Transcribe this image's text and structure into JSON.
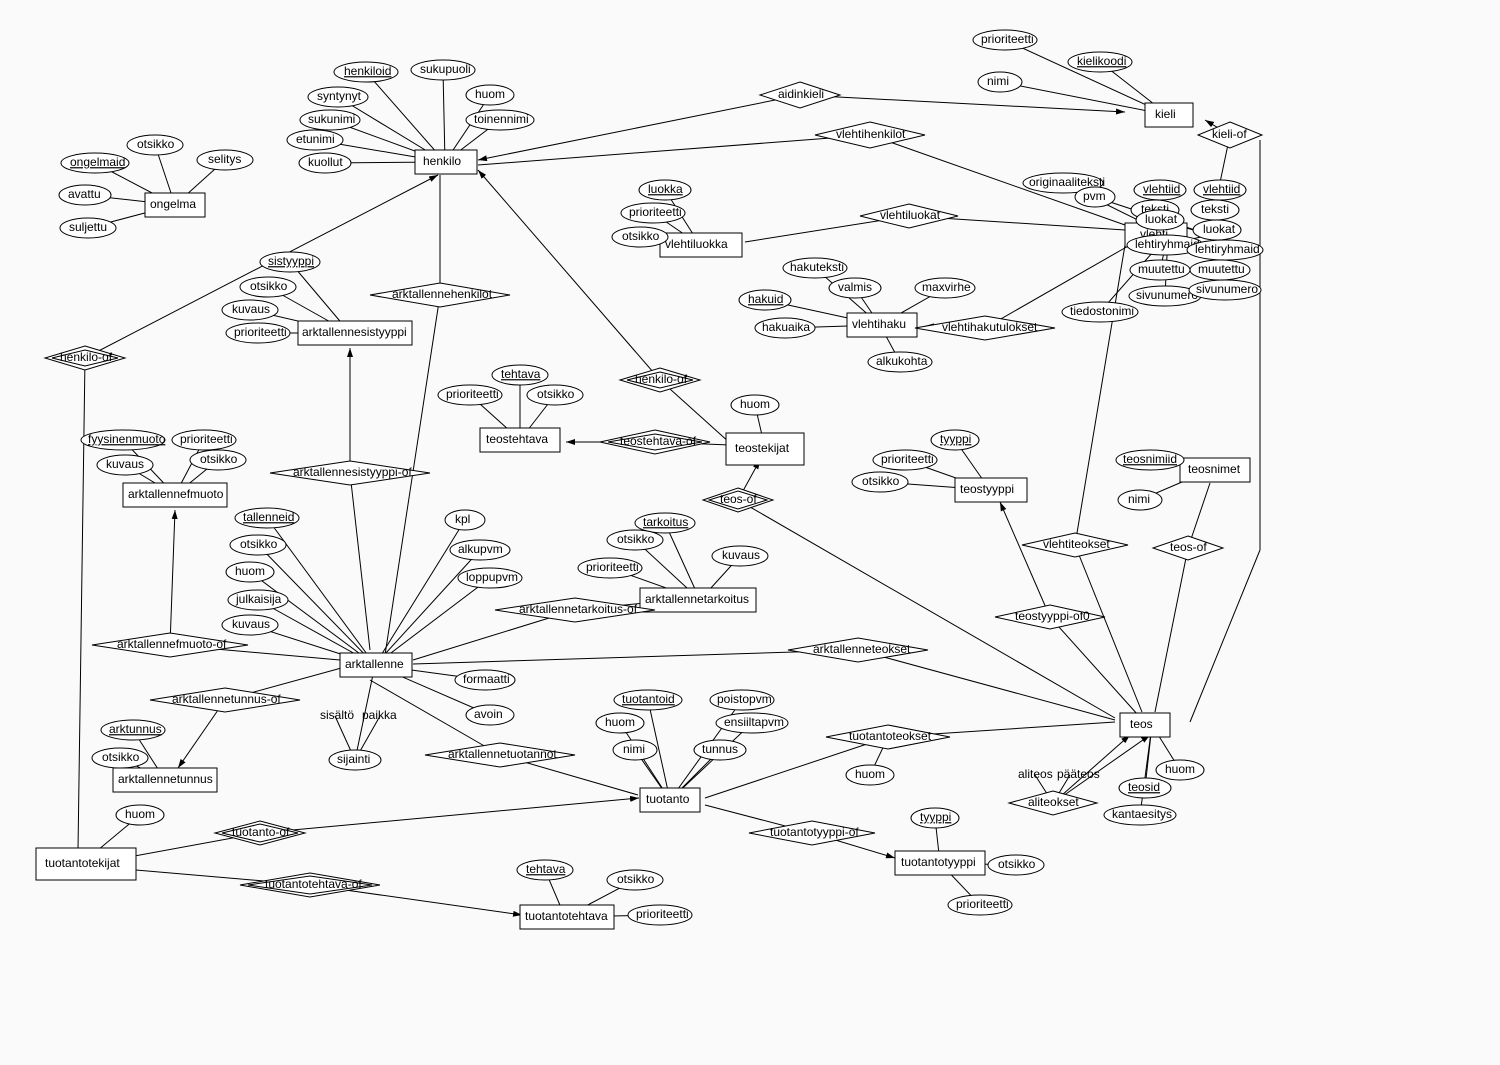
{
  "entities": {
    "ongelma": "ongelma",
    "henkilo": "henkilo",
    "kieli": "kieli",
    "vlehti": "vlehti",
    "vlehtiluokka": "vlehtiluokka",
    "vlehtihaku": "vlehtihaku",
    "arktallennesistyyppi": "arktallennesistyyppi",
    "teostehtava": "teostehtava",
    "teostekijat": "teostekijat",
    "teostyyppi": "teostyyppi",
    "teosnimet": "teosnimet",
    "arktallennefmuoto": "arktallennefmuoto",
    "arktallenne": "arktallenne",
    "arktallennetarkoitus": "arktallennetarkoitus",
    "arktallennetunnus": "arktallennetunnus",
    "tuotanto": "tuotanto",
    "teos": "teos",
    "tuotantotekijat": "tuotantotekijat",
    "tuotantotehtava": "tuotantotehtava",
    "tuotantotyyppi": "tuotantotyyppi"
  },
  "relationships": {
    "aidinkieli": "aidinkieli",
    "vlehtihenkilot": "vlehtihenkilot",
    "kieli_of": "kieli-of",
    "vlehtiluokat": "vlehtiluokat",
    "vlehtihakutulokset": "vlehtihakutulokset",
    "arktallennehenkilot": "arktallennehenkilot",
    "henkilo_of1": "henkilo-of",
    "henkilo_of2": "henkilo-of",
    "arktallennesistyyppi_of": "arktallennesistyyppi-of",
    "teostehtava_of": "teostehtava-of",
    "teos_of1": "teos-of",
    "teos_of2": "teos-of",
    "vlehtiteokset": "vlehtiteokset",
    "teostyyppi_of": "teostyyppi-of0",
    "arktallennefmuoto_of": "arktallennefmuoto-of",
    "arktallennetarkoitus_of": "arktallennetarkoitus-of",
    "arktallenneteokset": "arktallenneteokset",
    "arktallennetunnus_of": "arktallennetunnus-of",
    "arktallennetuotannot": "arktallennetuotannot",
    "tuotantoteokset": "tuotantoteokset",
    "aliteokset": "aliteokset",
    "tuotanto_of": "tuotanto-of",
    "tuotantotehtava_of": "tuotantotehtava-of",
    "tuotantotyyppi_of": "tuotantotyyppi-of"
  },
  "attributes": {
    "ongelma": {
      "ongelmaid": "ongelmaid",
      "otsikko": "otsikko",
      "selitys": "selitys",
      "avattu": "avattu",
      "suljettu": "suljettu"
    },
    "henkilo": {
      "henkiloid": "henkiloid",
      "sukupuoli": "sukupuoli",
      "huom": "huom",
      "toinennimi": "toinennimi",
      "syntynyt": "syntynyt",
      "sukunimi": "sukunimi",
      "etunimi": "etunimi",
      "kuollut": "kuollut"
    },
    "kieli": {
      "prioriteetti": "prioriteetti",
      "kielikoodi": "kielikoodi",
      "nimi": "nimi"
    },
    "vlehti": {
      "originaaliteksti": "originaaliteksti",
      "vlehtiid": "vlehtiid",
      "teksti": "teksti",
      "luokat": "luokat",
      "lehtiryhmaid": "lehtiryhmaid",
      "muutettu": "muutettu",
      "sivunumero": "sivunumero",
      "tiedostonimi": "tiedostonimi",
      "pvm": "pvm"
    },
    "vlehtiluokka": {
      "luokka": "luokka",
      "prioriteetti": "prioriteetti",
      "otsikko": "otsikko"
    },
    "vlehtihaku": {
      "hakuteksti": "hakuteksti",
      "valmis": "valmis",
      "maxvirhe": "maxvirhe",
      "hakuid": "hakuid",
      "hakuaika": "hakuaika",
      "alkukohta": "alkukohta"
    },
    "arktallennesistyyppi": {
      "sistyyppi": "sistyyppi",
      "otsikko": "otsikko",
      "kuvaus": "kuvaus",
      "prioriteetti": "prioriteetti"
    },
    "teostehtava": {
      "tehtava": "tehtava",
      "prioriteetti": "prioriteetti",
      "otsikko": "otsikko"
    },
    "teostekijat": {
      "huom": "huom"
    },
    "teostyyppi": {
      "tyyppi": "tyyppi",
      "prioriteetti": "prioriteetti",
      "otsikko": "otsikko"
    },
    "teosnimet": {
      "teosnimiid": "teosnimiid",
      "nimi": "nimi"
    },
    "arktallennefmuoto": {
      "fyysinenmuoto": "fyysinenmuoto",
      "prioriteetti": "prioriteetti",
      "otsikko": "otsikko",
      "kuvaus": "kuvaus"
    },
    "arktallenne": {
      "tallenneid": "tallenneid",
      "otsikko": "otsikko",
      "huom": "huom",
      "julkaisija": "julkaisija",
      "kuvaus": "kuvaus",
      "kpl": "kpl",
      "alkupvm": "alkupvm",
      "loppupvm": "loppupvm",
      "formaatti": "formaatti",
      "avoin": "avoin",
      "sisalto": "sisältö",
      "paikka": "paikka",
      "sijainti": "sijainti"
    },
    "arktallennetarkoitus": {
      "tarkoitus": "tarkoitus",
      "otsikko": "otsikko",
      "prioriteetti": "prioriteetti",
      "kuvaus": "kuvaus"
    },
    "arktallennetunnus": {
      "arktunnus": "arktunnus",
      "otsikko": "otsikko"
    },
    "tuotanto": {
      "tuotantoid": "tuotantoid",
      "poistopvm": "poistopvm",
      "ensiiltapvm": "ensiiltapvm",
      "huom": "huom",
      "nimi": "nimi",
      "tunnus": "tunnus"
    },
    "tuotantoteokset": {
      "huom": "huom"
    },
    "teos": {
      "huom": "huom",
      "teosid": "teosid",
      "kantaesitys": "kantaesitys",
      "aliteos": "aliteos",
      "paateos": "pääteos"
    },
    "tuotantotekijat": {
      "huom": "huom"
    },
    "tuotantotehtava": {
      "tehtava": "tehtava",
      "otsikko": "otsikko",
      "prioriteetti": "prioriteetti"
    },
    "tuotantotyyppi": {
      "tyyppi": "tyyppi",
      "otsikko": "otsikko",
      "prioriteetti": "prioriteetti"
    }
  }
}
